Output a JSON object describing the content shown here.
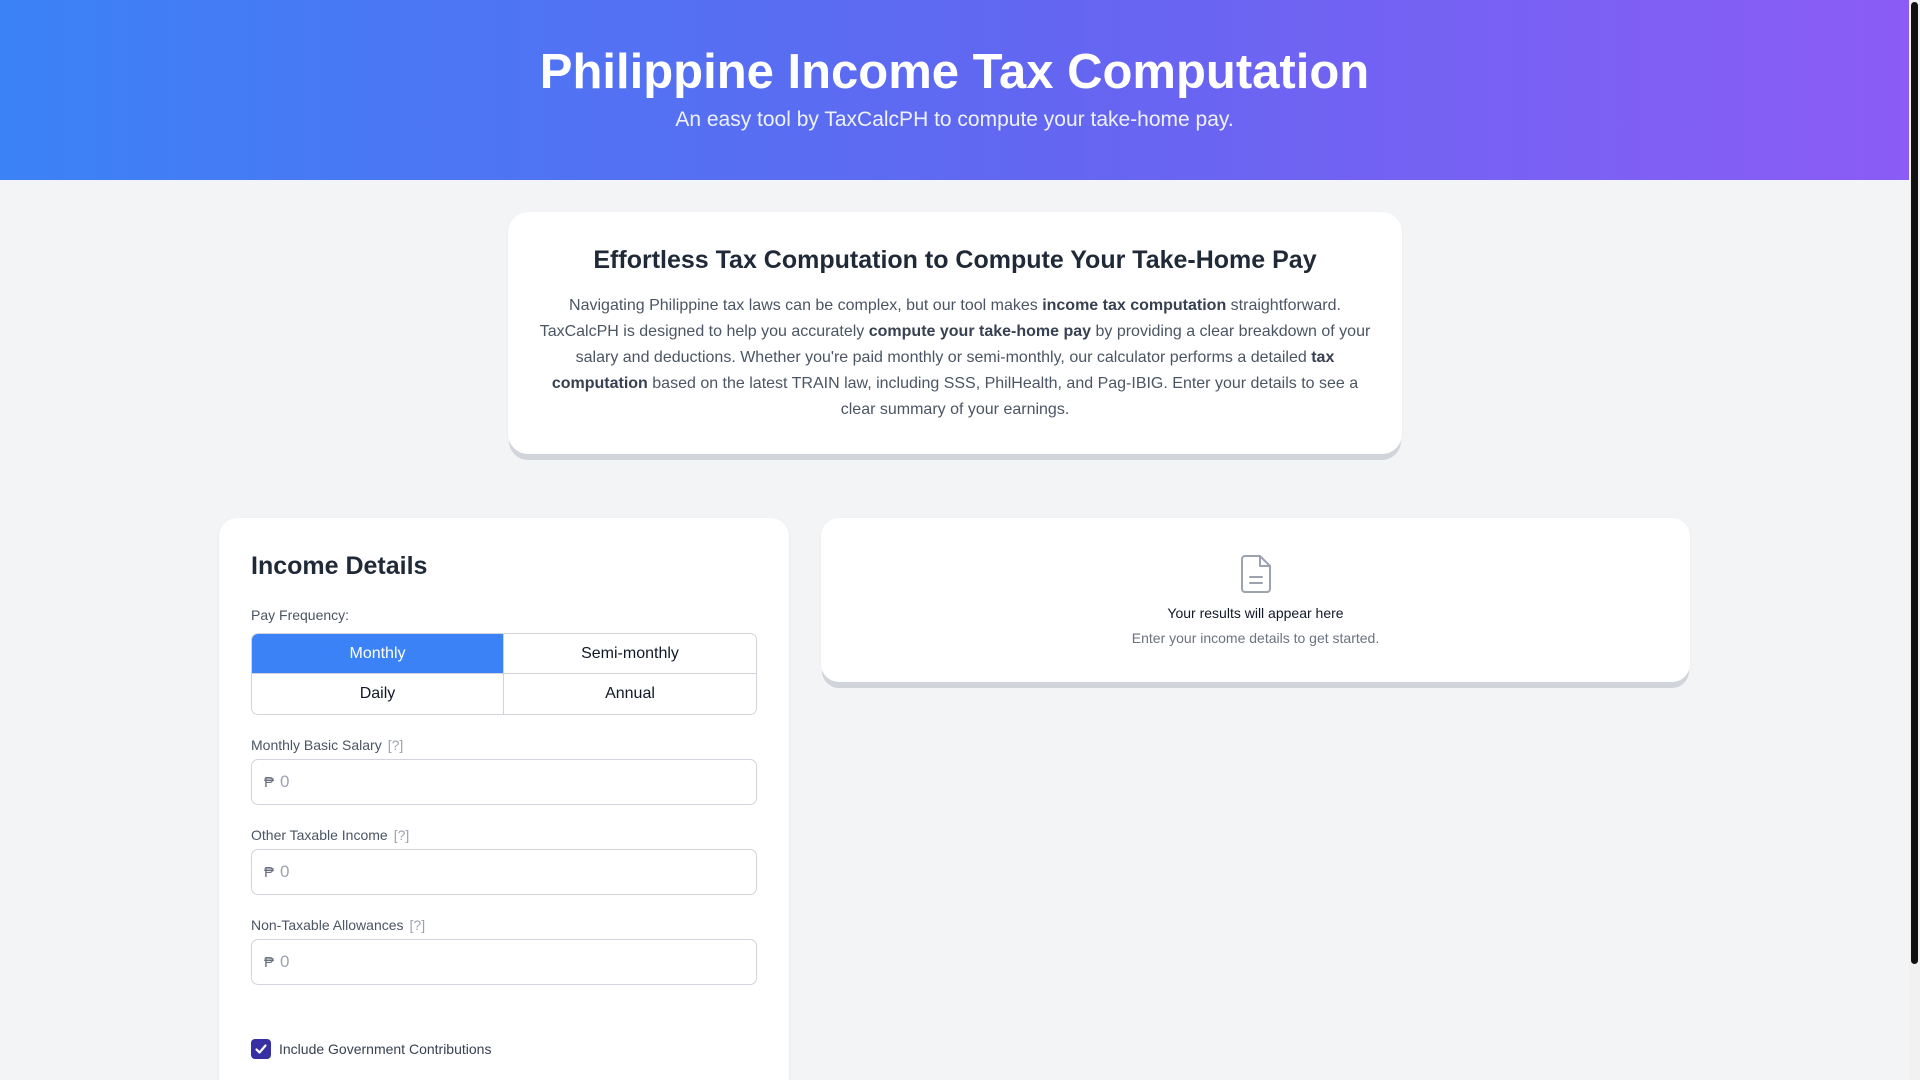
{
  "hero": {
    "title": "Philippine Income Tax Computation",
    "subtitle": "An easy tool by TaxCalcPH to compute your take-home pay."
  },
  "intro": {
    "heading": "Effortless Tax Computation to Compute Your Take-Home Pay",
    "p1": "Navigating Philippine tax laws can be complex, but our tool makes ",
    "b1": "income tax computation",
    "p2": " straightforward. TaxCalcPH is designed to help you accurately ",
    "b2": "compute your take-home pay",
    "p3": " by providing a clear breakdown of your salary and deductions. Whether you're paid monthly or semi-monthly, our calculator performs a detailed ",
    "b3": "tax computation",
    "p4": " based on the latest TRAIN law, including SSS, PhilHealth, and Pag-IBIG. Enter your details to see a clear summary of your earnings."
  },
  "form": {
    "heading": "Income Details",
    "pay_frequency_label": "Pay Frequency:",
    "frequency_options": [
      "Monthly",
      "Semi-monthly",
      "Daily",
      "Annual"
    ],
    "selected_frequency": "Monthly",
    "help_marker": "[?]",
    "currency_symbol": "₱",
    "fields": {
      "basic_salary": {
        "label": "Monthly Basic Salary",
        "placeholder": "0",
        "value": ""
      },
      "other_taxable": {
        "label": "Other Taxable Income",
        "placeholder": "0",
        "value": ""
      },
      "non_taxable": {
        "label": "Non-Taxable Allowances",
        "placeholder": "0",
        "value": ""
      }
    },
    "gov_contrib": {
      "label": "Include Government Contributions",
      "checked": true
    }
  },
  "results": {
    "icon": "document-icon",
    "title": "Your results will appear here",
    "subtitle": "Enter your income details to get started."
  },
  "colors": {
    "hero_gradient_start": "#3b82f6",
    "hero_gradient_end": "#8b5cf6",
    "accent": "#3b82f6",
    "checkbox": "#3730a3"
  }
}
